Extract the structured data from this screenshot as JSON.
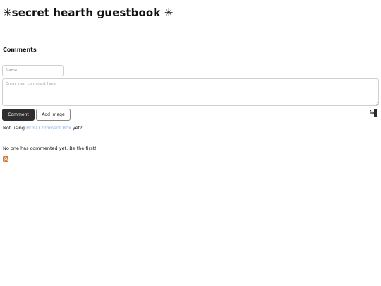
{
  "page": {
    "title": "✳secret hearth guestbook ✳"
  },
  "comments": {
    "heading": "Comments",
    "name_placeholder": "Name",
    "comment_placeholder": "Enter your comment here",
    "comment_button": "Comment",
    "add_image_button": "Add Image",
    "promo_prefix": "Not using",
    "promo_link": "Html Comment Box",
    "promo_suffix": "yet?",
    "empty_message": "No one has commented yet. Be the first!"
  },
  "icons": {
    "login": "login-icon",
    "rss": "rss-feed-icon"
  },
  "colors": {
    "button_dark": "#2e2e2e",
    "link": "#8cb4e4",
    "rss": "#e8762b"
  }
}
